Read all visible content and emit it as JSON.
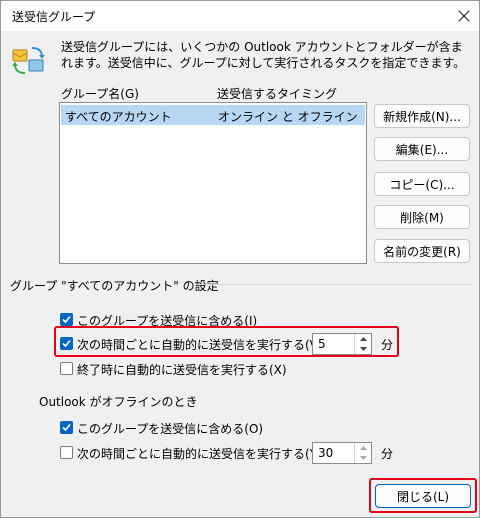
{
  "window": {
    "title": "送受信グループ"
  },
  "description": "送受信グループには、いくつかの Outlook アカウントとフォルダーが含まれます。送受信中に、グループに対して実行されるタスクを指定できます。",
  "list": {
    "headers": {
      "name": "グループ名(G)",
      "timing": "送受信するタイミング"
    },
    "rows": [
      {
        "name": "すべてのアカウント",
        "timing": "オンライン と オフライン",
        "selected": true
      }
    ]
  },
  "buttons": {
    "new": "新規作成(N)...",
    "edit": "編集(E)...",
    "copy": "コピー(C)...",
    "delete": "削除(M)",
    "rename": "名前の変更(R)",
    "close": "閉じる(L)"
  },
  "group_settings": {
    "label": "グループ \"すべてのアカウント\" の設定",
    "include": {
      "label": "このグループを送受信に含める(I)",
      "checked": true
    },
    "schedule": {
      "label": "次の時間ごとに自動的に送受信を実行する(V)",
      "checked": true,
      "value": "5",
      "unit": "分"
    },
    "on_exit": {
      "label": "終了時に自動的に送受信を実行する(X)",
      "checked": false
    }
  },
  "offline": {
    "label": "Outlook がオフラインのとき",
    "include": {
      "label": "このグループを送受信に含める(O)",
      "checked": true
    },
    "schedule": {
      "label": "次の時間ごとに自動的に送受信を実行する(Y)",
      "checked": false,
      "value": "30",
      "unit": "分"
    }
  },
  "colors": {
    "accent": "#0067c0",
    "highlight": "#e3001b",
    "selection": "#b8d7f2"
  }
}
